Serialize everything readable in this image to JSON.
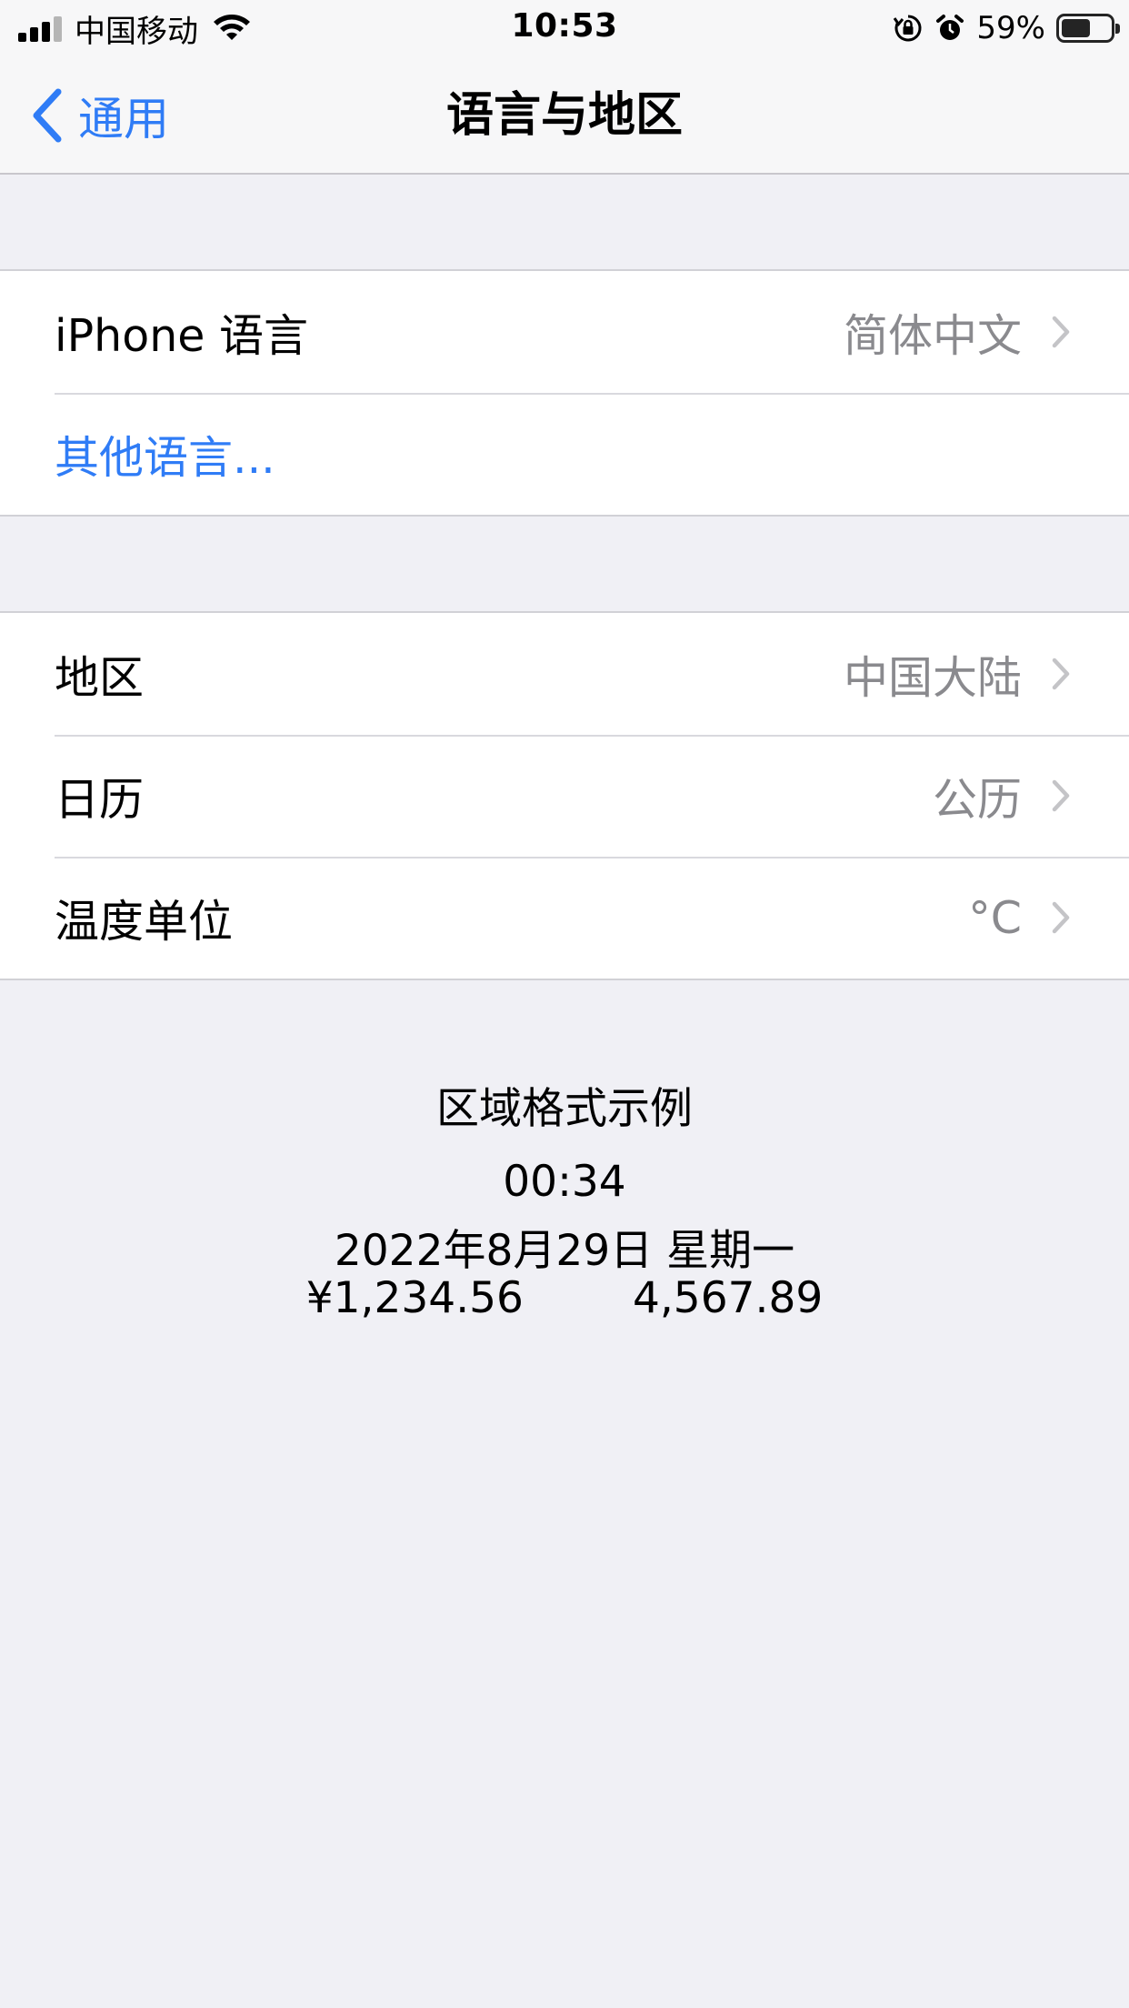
{
  "status_bar": {
    "carrier": "中国移动",
    "time": "10:53",
    "battery_percent": "59%",
    "battery_level": 0.59
  },
  "nav": {
    "back_label": "通用",
    "title": "语言与地区"
  },
  "language_group": {
    "iphone_language_label": "iPhone 语言",
    "iphone_language_value": "简体中文",
    "other_languages_label": "其他语言..."
  },
  "region_group": {
    "region_label": "地区",
    "region_value": "中国大陆",
    "calendar_label": "日历",
    "calendar_value": "公历",
    "temperature_label": "温度单位",
    "temperature_value": "°C"
  },
  "format_example": {
    "title": "区域格式示例",
    "time": "00:34",
    "date": "2022年8月29日 星期一",
    "currency": "¥1,234.56",
    "number": "4,567.89"
  },
  "colors": {
    "accent": "#2f7cf6",
    "background": "#f0f0f5",
    "secondary_text": "#8a8a8e"
  }
}
